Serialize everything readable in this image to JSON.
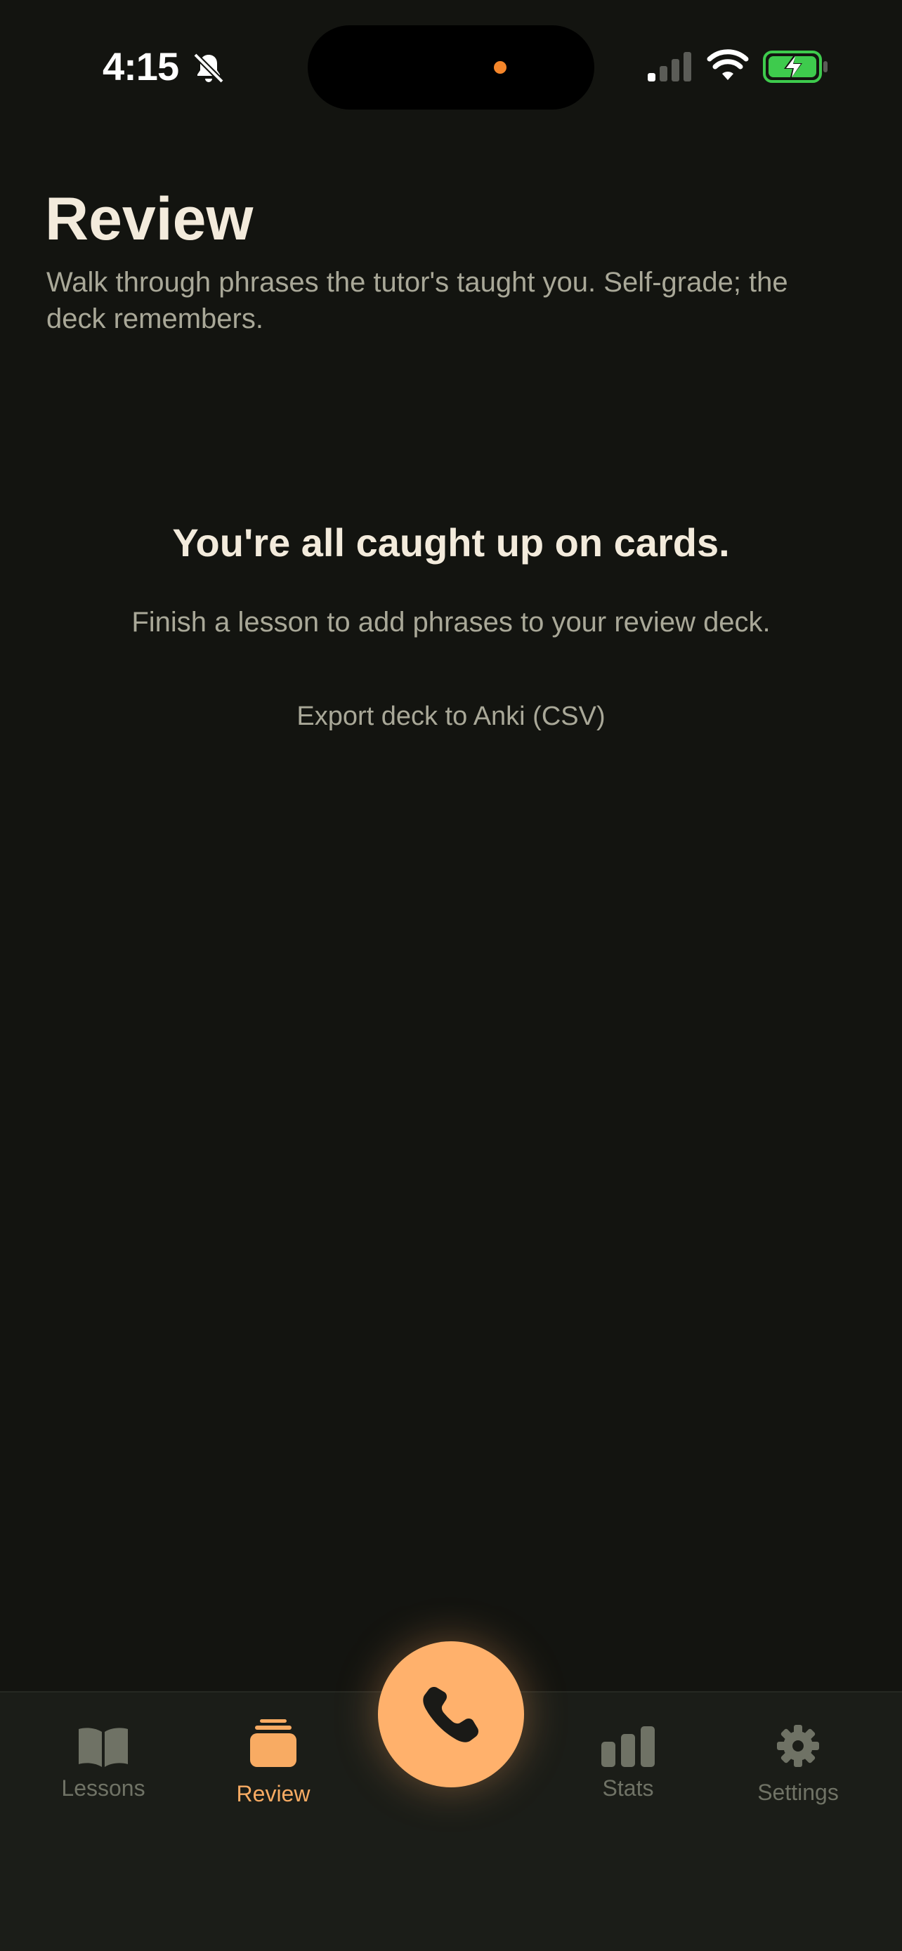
{
  "status_bar": {
    "time": "4:15"
  },
  "header": {
    "title": "Review",
    "subtitle": "Walk through phrases the tutor's taught you. Self-grade; the deck remembers."
  },
  "empty_state": {
    "title": "You're all caught up on cards.",
    "description": "Finish a lesson to add phrases to your review deck.",
    "export_label": "Export deck to Anki (CSV)"
  },
  "tab_bar": {
    "tabs": [
      {
        "label": "Lessons",
        "icon": "book-icon",
        "active": false
      },
      {
        "label": "Review",
        "icon": "card-stack-icon",
        "active": true
      },
      {
        "label": "Stats",
        "icon": "bar-chart-icon",
        "active": false
      },
      {
        "label": "Settings",
        "icon": "gear-icon",
        "active": false
      }
    ],
    "call_button_icon": "phone-icon"
  },
  "colors": {
    "background": "#131410",
    "accent": "#ffb16c",
    "active_tab": "#f8ab63",
    "title_text": "#f3ebdc",
    "muted_text": "#a9a898",
    "inactive_tab": "#6f7265",
    "island_dot": "#f5862a",
    "battery_green": "#3ecb4d"
  }
}
